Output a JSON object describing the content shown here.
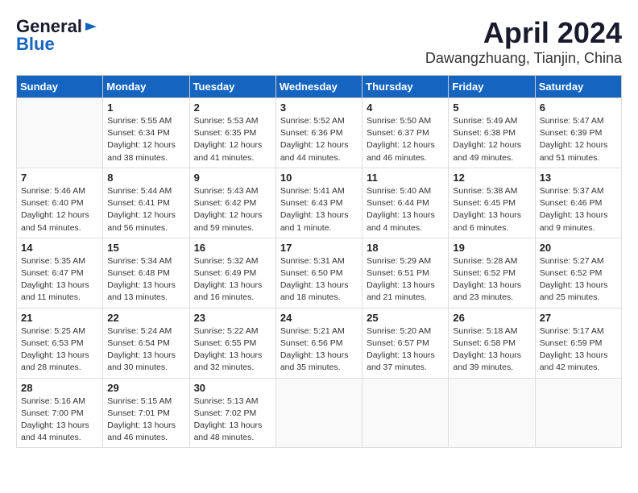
{
  "logo": {
    "line1": "General",
    "line2": "Blue"
  },
  "title": "April 2024",
  "subtitle": "Dawangzhuang, Tianjin, China",
  "days_of_week": [
    "Sunday",
    "Monday",
    "Tuesday",
    "Wednesday",
    "Thursday",
    "Friday",
    "Saturday"
  ],
  "weeks": [
    [
      {
        "day": "",
        "info": ""
      },
      {
        "day": "1",
        "info": "Sunrise: 5:55 AM\nSunset: 6:34 PM\nDaylight: 12 hours\nand 38 minutes."
      },
      {
        "day": "2",
        "info": "Sunrise: 5:53 AM\nSunset: 6:35 PM\nDaylight: 12 hours\nand 41 minutes."
      },
      {
        "day": "3",
        "info": "Sunrise: 5:52 AM\nSunset: 6:36 PM\nDaylight: 12 hours\nand 44 minutes."
      },
      {
        "day": "4",
        "info": "Sunrise: 5:50 AM\nSunset: 6:37 PM\nDaylight: 12 hours\nand 46 minutes."
      },
      {
        "day": "5",
        "info": "Sunrise: 5:49 AM\nSunset: 6:38 PM\nDaylight: 12 hours\nand 49 minutes."
      },
      {
        "day": "6",
        "info": "Sunrise: 5:47 AM\nSunset: 6:39 PM\nDaylight: 12 hours\nand 51 minutes."
      }
    ],
    [
      {
        "day": "7",
        "info": "Sunrise: 5:46 AM\nSunset: 6:40 PM\nDaylight: 12 hours\nand 54 minutes."
      },
      {
        "day": "8",
        "info": "Sunrise: 5:44 AM\nSunset: 6:41 PM\nDaylight: 12 hours\nand 56 minutes."
      },
      {
        "day": "9",
        "info": "Sunrise: 5:43 AM\nSunset: 6:42 PM\nDaylight: 12 hours\nand 59 minutes."
      },
      {
        "day": "10",
        "info": "Sunrise: 5:41 AM\nSunset: 6:43 PM\nDaylight: 13 hours\nand 1 minute."
      },
      {
        "day": "11",
        "info": "Sunrise: 5:40 AM\nSunset: 6:44 PM\nDaylight: 13 hours\nand 4 minutes."
      },
      {
        "day": "12",
        "info": "Sunrise: 5:38 AM\nSunset: 6:45 PM\nDaylight: 13 hours\nand 6 minutes."
      },
      {
        "day": "13",
        "info": "Sunrise: 5:37 AM\nSunset: 6:46 PM\nDaylight: 13 hours\nand 9 minutes."
      }
    ],
    [
      {
        "day": "14",
        "info": "Sunrise: 5:35 AM\nSunset: 6:47 PM\nDaylight: 13 hours\nand 11 minutes."
      },
      {
        "day": "15",
        "info": "Sunrise: 5:34 AM\nSunset: 6:48 PM\nDaylight: 13 hours\nand 13 minutes."
      },
      {
        "day": "16",
        "info": "Sunrise: 5:32 AM\nSunset: 6:49 PM\nDaylight: 13 hours\nand 16 minutes."
      },
      {
        "day": "17",
        "info": "Sunrise: 5:31 AM\nSunset: 6:50 PM\nDaylight: 13 hours\nand 18 minutes."
      },
      {
        "day": "18",
        "info": "Sunrise: 5:29 AM\nSunset: 6:51 PM\nDaylight: 13 hours\nand 21 minutes."
      },
      {
        "day": "19",
        "info": "Sunrise: 5:28 AM\nSunset: 6:52 PM\nDaylight: 13 hours\nand 23 minutes."
      },
      {
        "day": "20",
        "info": "Sunrise: 5:27 AM\nSunset: 6:52 PM\nDaylight: 13 hours\nand 25 minutes."
      }
    ],
    [
      {
        "day": "21",
        "info": "Sunrise: 5:25 AM\nSunset: 6:53 PM\nDaylight: 13 hours\nand 28 minutes."
      },
      {
        "day": "22",
        "info": "Sunrise: 5:24 AM\nSunset: 6:54 PM\nDaylight: 13 hours\nand 30 minutes."
      },
      {
        "day": "23",
        "info": "Sunrise: 5:22 AM\nSunset: 6:55 PM\nDaylight: 13 hours\nand 32 minutes."
      },
      {
        "day": "24",
        "info": "Sunrise: 5:21 AM\nSunset: 6:56 PM\nDaylight: 13 hours\nand 35 minutes."
      },
      {
        "day": "25",
        "info": "Sunrise: 5:20 AM\nSunset: 6:57 PM\nDaylight: 13 hours\nand 37 minutes."
      },
      {
        "day": "26",
        "info": "Sunrise: 5:18 AM\nSunset: 6:58 PM\nDaylight: 13 hours\nand 39 minutes."
      },
      {
        "day": "27",
        "info": "Sunrise: 5:17 AM\nSunset: 6:59 PM\nDaylight: 13 hours\nand 42 minutes."
      }
    ],
    [
      {
        "day": "28",
        "info": "Sunrise: 5:16 AM\nSunset: 7:00 PM\nDaylight: 13 hours\nand 44 minutes."
      },
      {
        "day": "29",
        "info": "Sunrise: 5:15 AM\nSunset: 7:01 PM\nDaylight: 13 hours\nand 46 minutes."
      },
      {
        "day": "30",
        "info": "Sunrise: 5:13 AM\nSunset: 7:02 PM\nDaylight: 13 hours\nand 48 minutes."
      },
      {
        "day": "",
        "info": ""
      },
      {
        "day": "",
        "info": ""
      },
      {
        "day": "",
        "info": ""
      },
      {
        "day": "",
        "info": ""
      }
    ]
  ]
}
